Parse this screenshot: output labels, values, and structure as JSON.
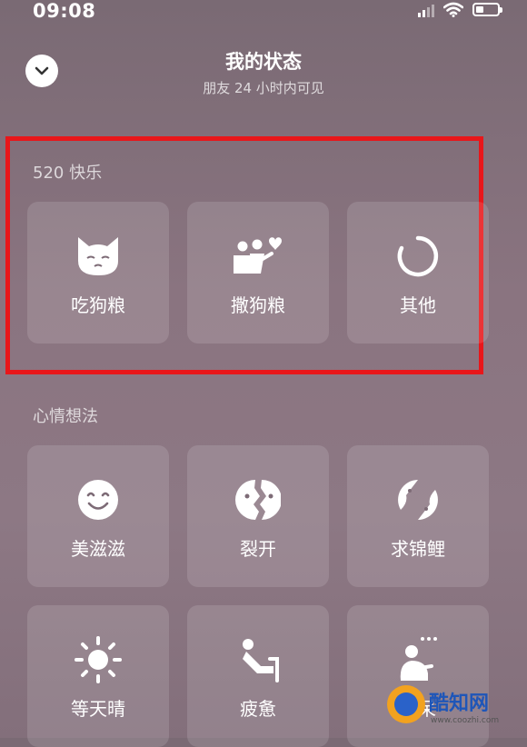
{
  "status_bar": {
    "time": "09:08"
  },
  "header": {
    "title": "我的状态",
    "subtitle": "朋友 24 小时内可见"
  },
  "sections": [
    {
      "label": "520 快乐",
      "items": [
        {
          "label": "吃狗粮",
          "icon": "cat-face-icon"
        },
        {
          "label": "撒狗粮",
          "icon": "couple-heart-icon"
        },
        {
          "label": "其他",
          "icon": "loading-ring-icon"
        }
      ]
    },
    {
      "label": "心情想法",
      "items": [
        {
          "label": "美滋滋",
          "icon": "smile-face-icon"
        },
        {
          "label": "裂开",
          "icon": "cracked-face-icon"
        },
        {
          "label": "求锦鲤",
          "icon": "koi-fish-icon"
        },
        {
          "label": "等天晴",
          "icon": "sun-icon"
        },
        {
          "label": "疲惫",
          "icon": "tired-person-icon"
        },
        {
          "label": "发呆",
          "icon": "daze-person-icon"
        }
      ]
    }
  ],
  "watermark": {
    "name": "酷知网",
    "url": "www.coozhi.com"
  },
  "colors": {
    "highlight_border": "#e8161a",
    "card_bg": "rgba(255,255,255,0.13)"
  }
}
